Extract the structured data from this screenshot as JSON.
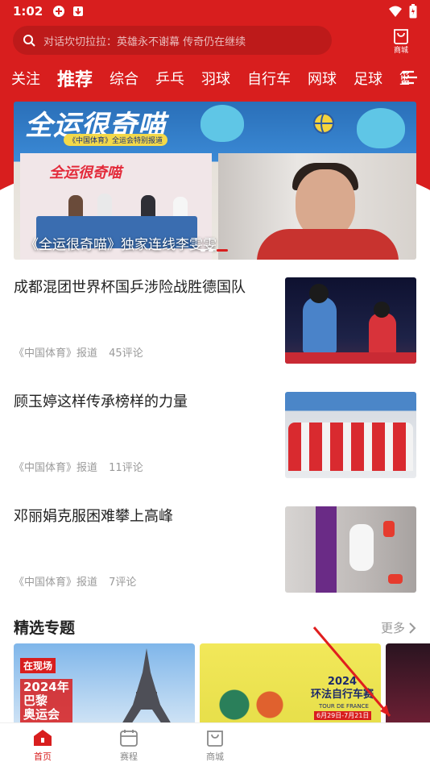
{
  "colors": {
    "brand_red": "#d81e1e",
    "text": "#222222",
    "meta": "#9a9a9a"
  },
  "status_bar": {
    "time": "1:02"
  },
  "header": {
    "search_placeholder": "对话坎切拉拉：英雄永不谢幕 传奇仍在继续",
    "shop_label": "商城"
  },
  "tabs": [
    {
      "label": "关注"
    },
    {
      "label": "推荐",
      "active": true
    },
    {
      "label": "综合"
    },
    {
      "label": "乒乓"
    },
    {
      "label": "羽球"
    },
    {
      "label": "自行车"
    },
    {
      "label": "网球"
    },
    {
      "label": "足球"
    },
    {
      "label": "篮"
    }
  ],
  "banner": {
    "title": "全运很奇喵",
    "badge": "《中国体育》全运会特别报道",
    "stage_sign": "全运很奇喵",
    "caption": "《全运很奇喵》独家连线李雯雯",
    "slide_count": 3,
    "active_slide": 2
  },
  "news": [
    {
      "title": "成都混团世界杯国乒涉险战胜德国队",
      "source": "《中国体育》报道",
      "comments": "45评论"
    },
    {
      "title": "顾玉婷这样传承榜样的力量",
      "source": "《中国体育》报道",
      "comments": "11评论"
    },
    {
      "title": "邓丽娟克服困难攀上高峰",
      "source": "《中国体育》报道",
      "comments": "7评论"
    }
  ],
  "featured": {
    "title": "精选专题",
    "more": "更多",
    "cards": [
      {
        "text": "2024年\n巴黎\n奥运会",
        "tag": "在现场"
      },
      {
        "text": "2024\n环法自行车赛",
        "sub": "TOUR DE FRANCE",
        "date": "6月29日-7月21日"
      }
    ]
  },
  "bottom_nav": [
    {
      "label": "首页",
      "active": true
    },
    {
      "label": "赛程"
    },
    {
      "label": "商城"
    }
  ]
}
